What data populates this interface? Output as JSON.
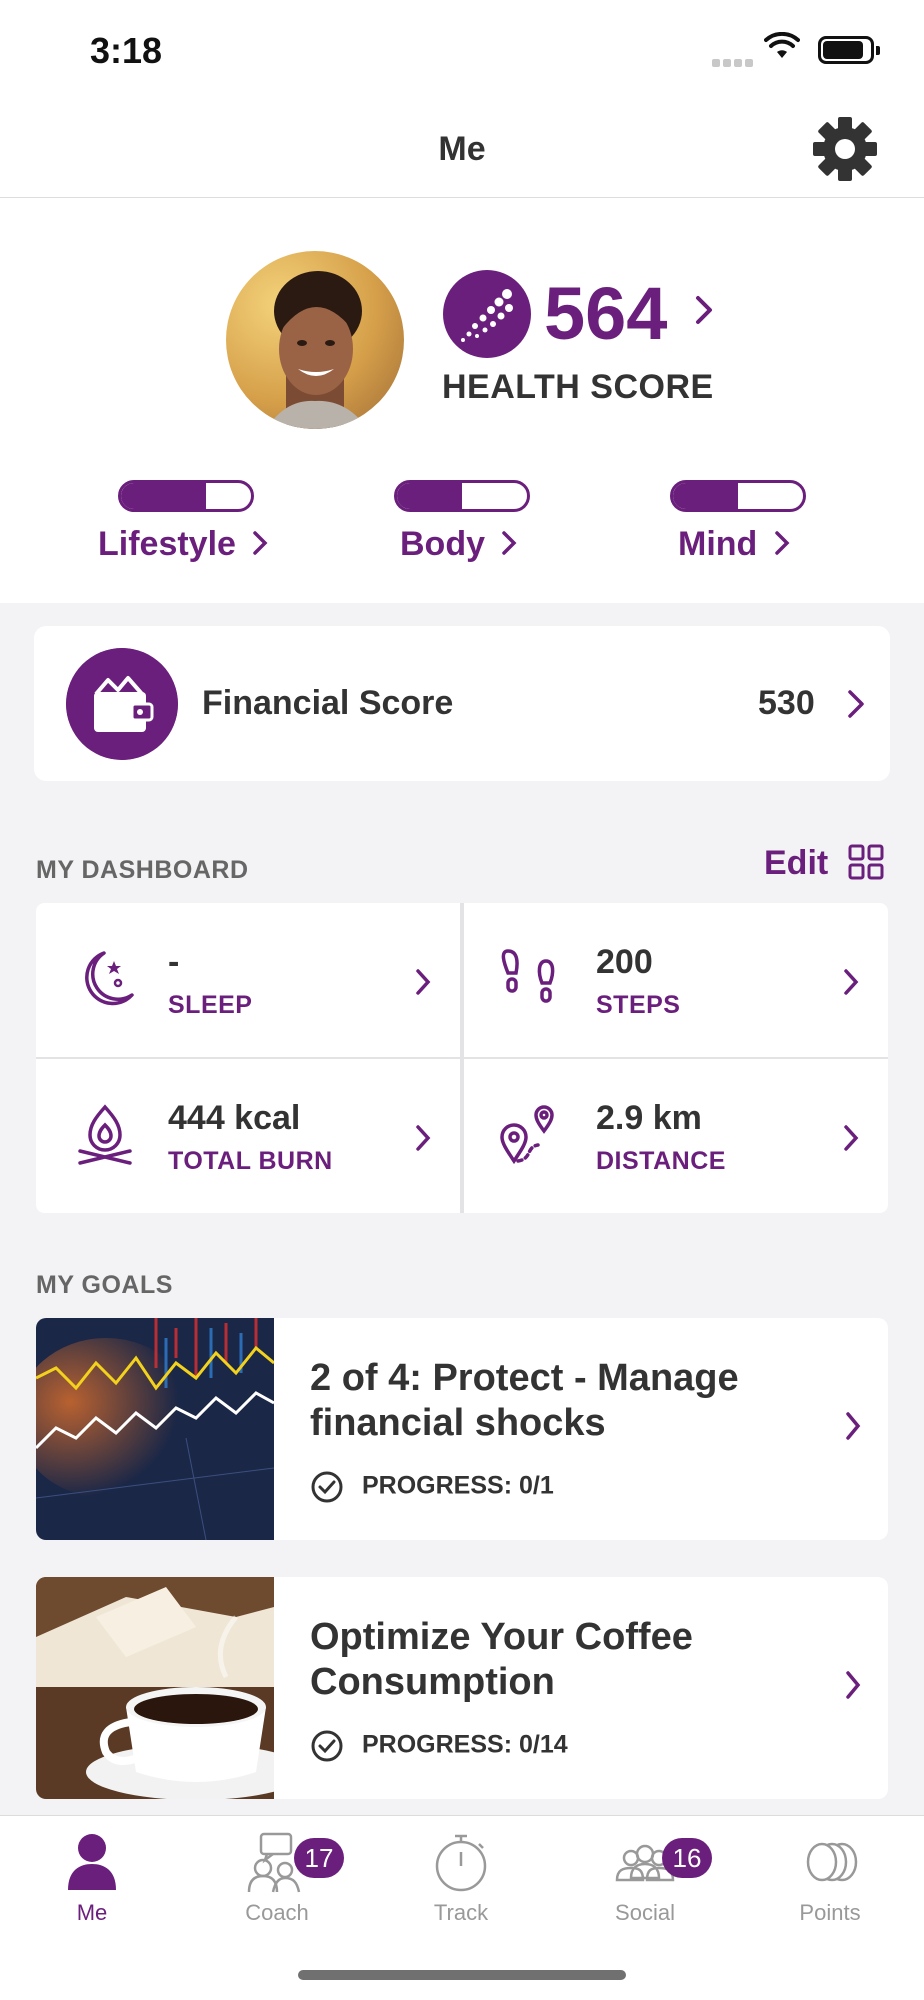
{
  "status": {
    "time": "3:18"
  },
  "nav": {
    "title": "Me"
  },
  "health": {
    "score": "564",
    "label": "HEALTH SCORE",
    "categories": [
      {
        "label": "Lifestyle",
        "level": 0.65
      },
      {
        "label": "Body",
        "level": 0.5
      },
      {
        "label": "Mind",
        "level": 0.5
      }
    ]
  },
  "financial": {
    "label": "Financial Score",
    "value": "530"
  },
  "dashboard": {
    "title": "MY DASHBOARD",
    "edit_label": "Edit",
    "tiles": [
      {
        "value": "-",
        "label": "SLEEP",
        "icon": "moon-icon"
      },
      {
        "value": "200",
        "label": "STEPS",
        "icon": "footprints-icon"
      },
      {
        "value": "444 kcal",
        "label": "TOTAL BURN",
        "icon": "flame-icon"
      },
      {
        "value": "2.9 km",
        "label": "DISTANCE",
        "icon": "route-pin-icon"
      }
    ]
  },
  "goals": {
    "title": "MY GOALS",
    "items": [
      {
        "title": "2 of 4: Protect - Manage financial shocks",
        "progress": "PROGRESS: 0/1"
      },
      {
        "title": "Optimize Your Coffee Consumption",
        "progress": "PROGRESS: 0/14"
      }
    ]
  },
  "tabs": [
    {
      "label": "Me",
      "badge": ""
    },
    {
      "label": "Coach",
      "badge": "17"
    },
    {
      "label": "Track",
      "badge": ""
    },
    {
      "label": "Social",
      "badge": "16"
    },
    {
      "label": "Points",
      "badge": ""
    }
  ],
  "colors": {
    "accent": "#6b1f7c",
    "background": "#f3f3f5"
  }
}
